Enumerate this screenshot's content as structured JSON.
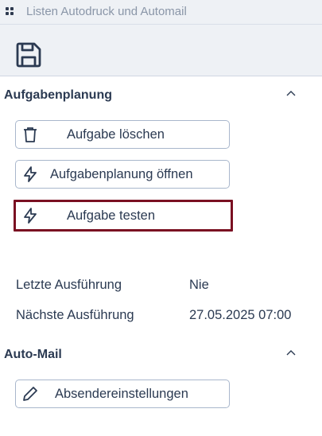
{
  "window": {
    "title": "Listen Autodruck und Automail"
  },
  "toolbar": {
    "save_icon": "save-icon"
  },
  "task_section": {
    "title": "Aufgabenplanung",
    "buttons": {
      "delete_label": "Aufgabe löschen",
      "open_label": "Aufgabenplanung öffnen",
      "test_label": "Aufgabe testen"
    },
    "last_run_label": "Letzte Ausführung",
    "last_run_value": "Nie",
    "next_run_label": "Nächste Ausführung",
    "next_run_value": "27.05.2025 07:00"
  },
  "mail_section": {
    "title": "Auto-Mail",
    "sender_label": "Absendereinstellungen"
  },
  "colors": {
    "background": "#ffffff",
    "titlebar": "#eef1f5",
    "text": "#2b3a52",
    "button_border": "#a9b7cc",
    "focus_border": "#7a1022"
  }
}
